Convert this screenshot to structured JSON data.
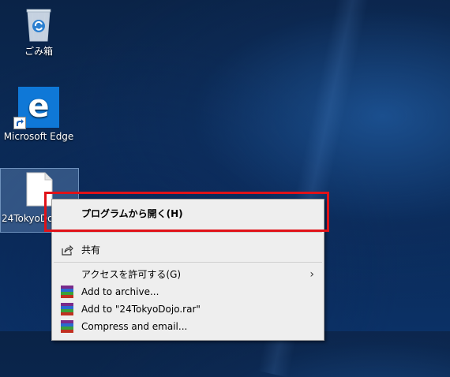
{
  "desktop": {
    "icons": [
      {
        "label": "ごみ箱",
        "icon": "recycle-bin-icon"
      },
      {
        "label": "Microsoft Edge",
        "icon": "edge-icon"
      },
      {
        "label": "24TokyoDojo",
        "icon": "file-icon"
      }
    ]
  },
  "context_menu": {
    "open_with": "プログラムから開く(H)",
    "share": "共有",
    "give_access": "アクセスを許可する(G)",
    "add_archive": "Add to archive...",
    "add_rar": "Add to \"24TokyoDojo.rar\"",
    "compress_email": "Compress and email..."
  },
  "colors": {
    "highlight": "#e01218",
    "menu_bg": "#eeeeee",
    "edge_blue": "#0f78d7"
  }
}
